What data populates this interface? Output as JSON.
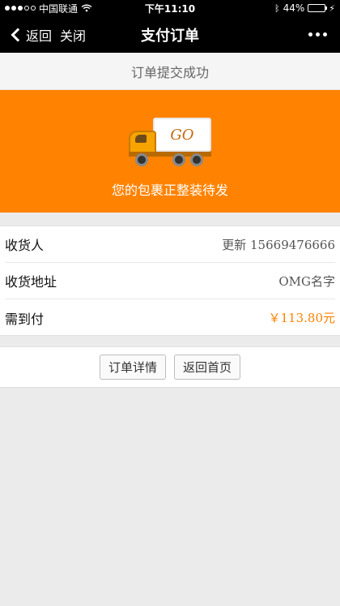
{
  "status_bar": {
    "carrier": "中国联通",
    "time": "下午11:10",
    "battery": "44%",
    "battery_level": 0.44
  },
  "nav": {
    "back_label": "返回",
    "close_label": "关闭",
    "title": "支付订单"
  },
  "submit_status": "订单提交成功",
  "banner": {
    "truck_text": "GO",
    "message": "您的包裹正整装待发"
  },
  "info": {
    "rows": [
      {
        "label": "收货人",
        "value": "更新 15669476666"
      },
      {
        "label": "收货地址",
        "value": "OMG名字"
      },
      {
        "label": "需到付",
        "value": "￥113.80元"
      }
    ]
  },
  "actions": {
    "order_detail": "订单详情",
    "back_home": "返回首页"
  },
  "colors": {
    "accent": "#ff8200",
    "navbar": "#000000",
    "background": "#ebebeb"
  },
  "icons": [
    "wifi-icon",
    "bluetooth-icon",
    "battery-icon",
    "charging-icon",
    "back-chevron-icon",
    "more-icon",
    "truck-icon"
  ]
}
